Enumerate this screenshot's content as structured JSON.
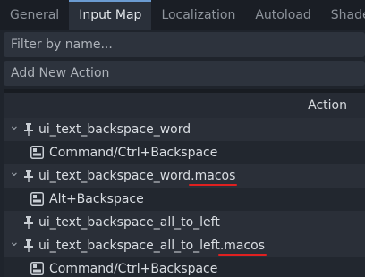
{
  "tabs": [
    {
      "label": "General",
      "active": false
    },
    {
      "label": "Input Map",
      "active": true
    },
    {
      "label": "Localization",
      "active": false
    },
    {
      "label": "Autoload",
      "active": false
    },
    {
      "label": "Shader",
      "active": false
    }
  ],
  "filter": {
    "placeholder": "Filter by name..."
  },
  "add_action": {
    "placeholder": "Add New Action"
  },
  "tree": {
    "header": "Action",
    "rows": [
      {
        "type": "action",
        "label": "ui_text_backspace_word",
        "expanded": true
      },
      {
        "type": "event",
        "label": "Command/Ctrl+Backspace"
      },
      {
        "type": "action",
        "label": "ui_text_backspace_word.macos",
        "expanded": true,
        "highlight": ".macos"
      },
      {
        "type": "event",
        "label": "Alt+Backspace"
      },
      {
        "type": "action",
        "label": "ui_text_backspace_all_to_left",
        "expanded": false
      },
      {
        "type": "action",
        "label": "ui_text_backspace_all_to_left.macos",
        "expanded": true,
        "highlight": ".macos"
      },
      {
        "type": "event",
        "label": "Command/Ctrl+Backspace"
      }
    ]
  },
  "colors": {
    "accent": "#6b9bd1",
    "highlight_underline": "#e02020"
  },
  "icons": {
    "expand": "chevron-down-icon",
    "action": "pin-icon",
    "event": "keyboard-icon"
  }
}
